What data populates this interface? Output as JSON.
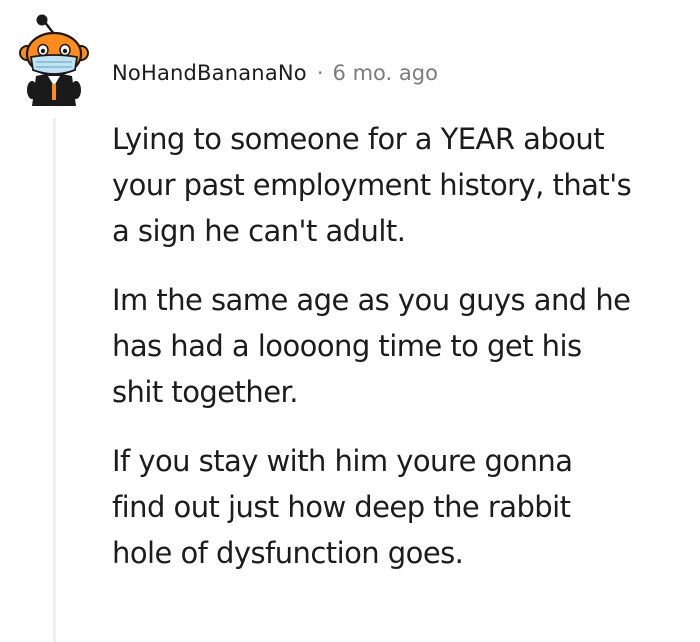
{
  "comment": {
    "username": "NoHandBananaNo",
    "separator": "·",
    "timestamp": "6 mo. ago",
    "avatar_icon": "snoo-avatar-icon",
    "paragraphs": [
      {
        "lines": [
          "Lying to someone for a YEAR about",
          "your past employment history, that's",
          "a sign he can't adult."
        ]
      },
      {
        "lines": [
          "Im the same age as you guys and he",
          "has had a loooong time to get his",
          "shit together."
        ]
      },
      {
        "lines": [
          "If you stay with him youre gonna",
          "find out just how deep the rabbit",
          "hole of dysfunction goes."
        ]
      }
    ]
  },
  "colors": {
    "text": "#1c1c1c",
    "meta": "#7c7c7c",
    "thread_line": "#edeff1",
    "snoo_orange": "#ff8c1a",
    "mask": "#bfe3f2",
    "suit": "#1a1a1a"
  }
}
